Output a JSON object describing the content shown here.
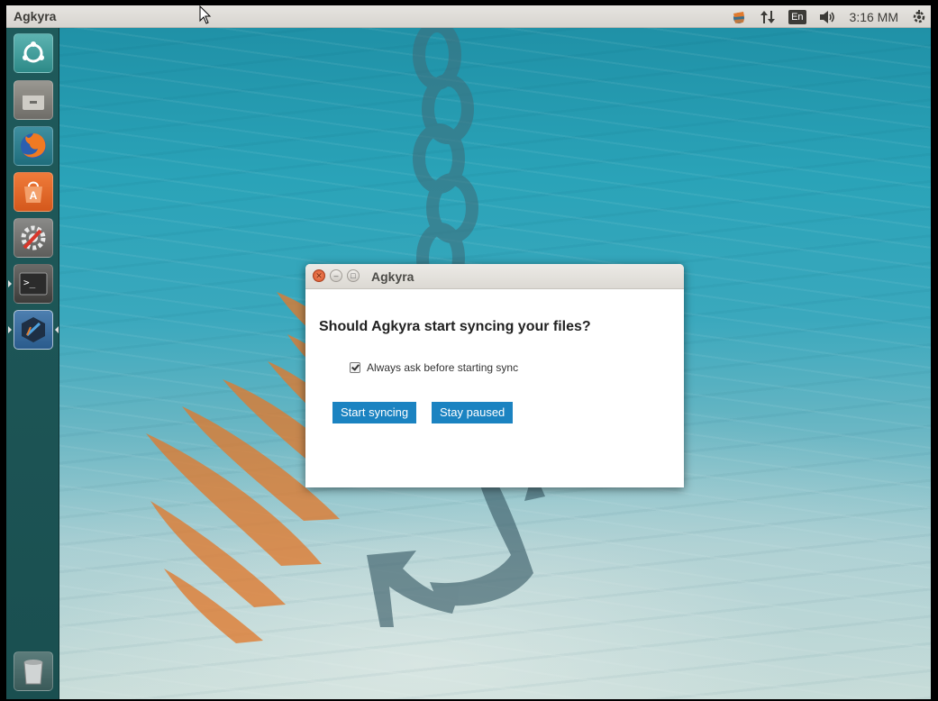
{
  "topbar": {
    "app_title": "Agkyra",
    "keyboard_layout": "En",
    "clock": "3:16 MM",
    "icons": [
      "agkyra-tray-icon",
      "network-updown-icon",
      "keyboard-layout-icon",
      "volume-icon",
      "session-gear-icon"
    ]
  },
  "launcher": {
    "items": [
      {
        "name": "ubuntu-dash-icon"
      },
      {
        "name": "files-icon"
      },
      {
        "name": "firefox-icon"
      },
      {
        "name": "software-center-icon"
      },
      {
        "name": "system-settings-icon"
      },
      {
        "name": "terminal-icon"
      },
      {
        "name": "agkyra-icon"
      },
      {
        "name": "trash-icon"
      }
    ]
  },
  "dialog": {
    "title": "Agkyra",
    "question": "Should Agkyra start syncing your files?",
    "checkbox_label": "Always ask before starting sync",
    "checkbox_checked": true,
    "start_button": "Start syncing",
    "pause_button": "Stay paused"
  },
  "colors": {
    "button_blue": "#1b83c1",
    "launcher_bg": "#1f5a5b",
    "close_orange": "#e8623a"
  }
}
